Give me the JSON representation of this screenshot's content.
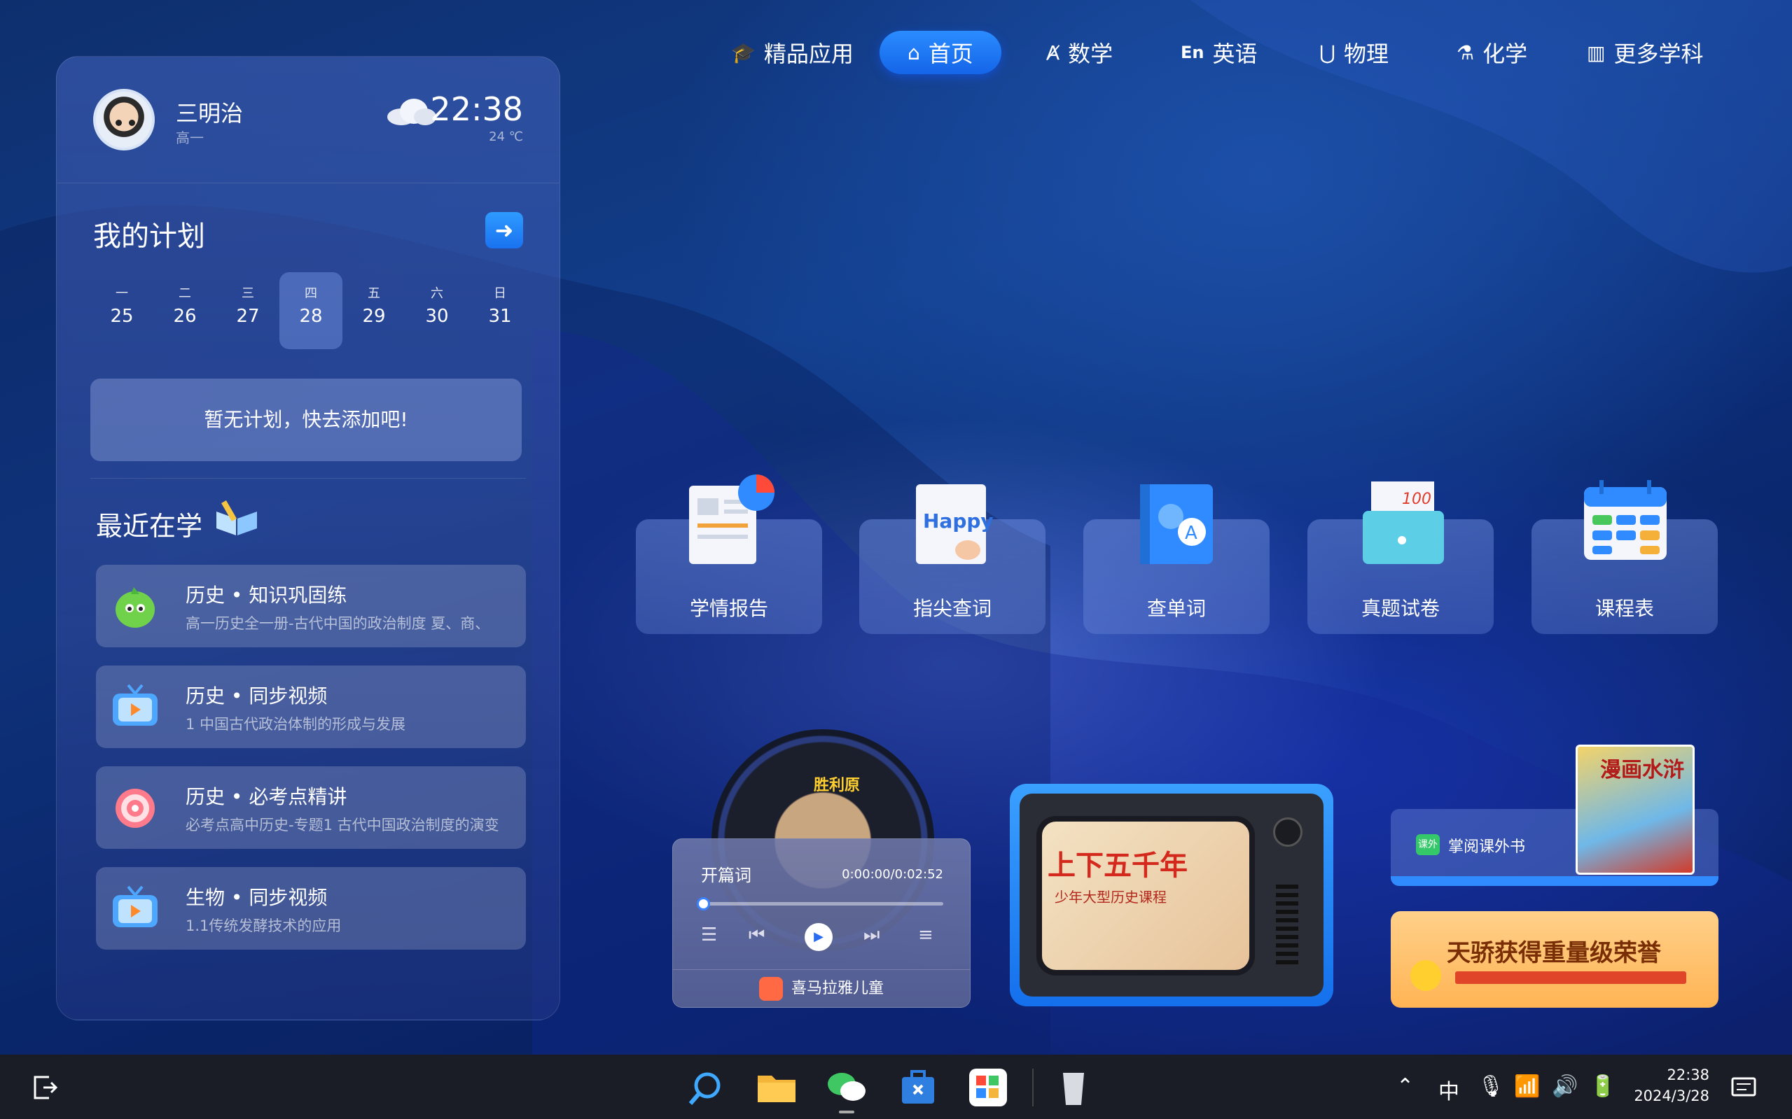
{
  "user": {
    "name": "三明治",
    "grade": "高一"
  },
  "weather": {
    "time": "22:38",
    "temp": "24 ℃",
    "icon": "cloud-icon"
  },
  "plan": {
    "title": "我的计划",
    "week": [
      {
        "day": "一",
        "date": "25"
      },
      {
        "day": "二",
        "date": "26"
      },
      {
        "day": "三",
        "date": "27"
      },
      {
        "day": "四",
        "date": "28"
      },
      {
        "day": "五",
        "date": "29"
      },
      {
        "day": "六",
        "date": "30"
      },
      {
        "day": "日",
        "date": "31"
      }
    ],
    "active_day": "四",
    "empty_text": "暂无计划，快去添加吧!"
  },
  "recent": {
    "title": "最近在学",
    "items": [
      {
        "title": "历史 • 知识巩固练",
        "subtitle": "高一历史全一册-古代中国的政治制度 夏、商、"
      },
      {
        "title": "历史 • 同步视频",
        "subtitle": "1 中国古代政治体制的形成与发展"
      },
      {
        "title": "历史 • 必考点精讲",
        "subtitle": "必考点高中历史-专题1 古代中国政治制度的演变"
      },
      {
        "title": "生物 • 同步视频",
        "subtitle": "1.1传统发酵技术的应用"
      }
    ]
  },
  "nav": {
    "items": [
      {
        "label": "精品应用",
        "icon": "graduation-cap-icon"
      },
      {
        "label": "首页",
        "icon": "home-icon"
      },
      {
        "label": "数学",
        "icon": "compass-icon"
      },
      {
        "label": "英语",
        "icon": "en-icon"
      },
      {
        "label": "物理",
        "icon": "magnet-icon"
      },
      {
        "label": "化学",
        "icon": "flask-icon"
      },
      {
        "label": "更多学科",
        "icon": "books-icon"
      }
    ],
    "active": "首页"
  },
  "tiles": [
    {
      "label": "学情报告",
      "icon": "report-icon"
    },
    {
      "label": "指尖查词",
      "icon": "fingertip-dictionary-icon"
    },
    {
      "label": "查单词",
      "icon": "translate-icon"
    },
    {
      "label": "真题试卷",
      "icon": "exam-paper-icon"
    },
    {
      "label": "课程表",
      "icon": "timetable-icon"
    }
  ],
  "player": {
    "track": "开篇词",
    "time": "0:00:00/0:02:52",
    "progress": 0,
    "source": "喜马拉雅儿童",
    "record_label": "胜利原"
  },
  "tv": {
    "title": "上下五千年",
    "subtitle": "少年大型历史课程"
  },
  "book": {
    "tag": "课外",
    "label": "掌阅课外书",
    "cover_title": "漫画水浒"
  },
  "banner": {
    "title": "天骄获得重量级荣誉"
  },
  "taskbar": {
    "apps": [
      "search-icon",
      "folder-icon",
      "wechat-icon",
      "toolbox-icon",
      "app-store-icon",
      "trash-icon"
    ],
    "tray": {
      "ime": "中",
      "time": "22:38",
      "date": "2024/3/28"
    }
  },
  "colors": {
    "accent": "#1a72f0",
    "background": "#0f3578",
    "taskbar": "#1a1d25"
  }
}
